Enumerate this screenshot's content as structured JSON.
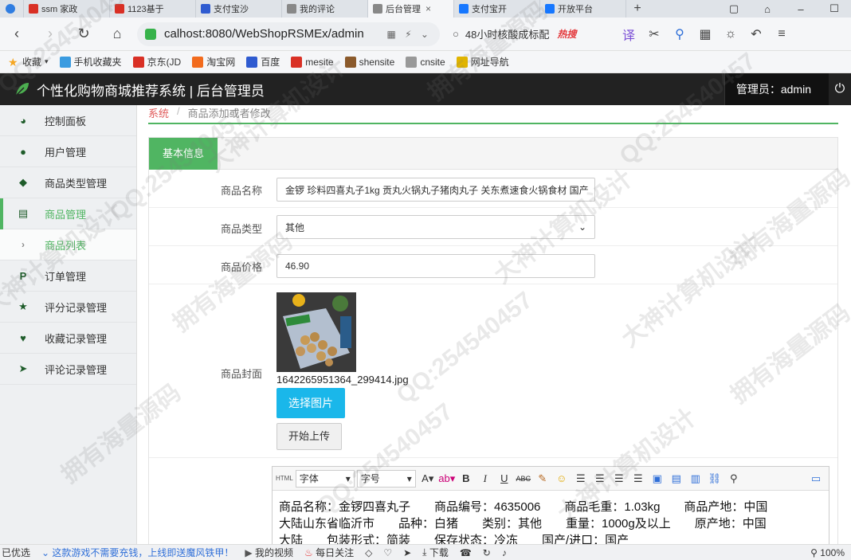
{
  "browser": {
    "tabs": [
      {
        "label": "ssm 家政",
        "color": "#d93025"
      },
      {
        "label": "1123基于",
        "color": "#d93025"
      },
      {
        "label": "支付宝沙",
        "color": "#2f5bd0"
      },
      {
        "label": "我的评论",
        "color": "#888888"
      },
      {
        "label": "后台管理",
        "color": "#888888",
        "active": true
      },
      {
        "label": "支付宝开",
        "color": "#1677ff"
      },
      {
        "label": "开放平台",
        "color": "#1677ff"
      }
    ],
    "address": "calhost:8080/WebShopRSMEx/admin",
    "search_text": "48小时核酸成标配",
    "search_hot": "热搜",
    "bookmarks": [
      "收藏",
      "手机收藏夹",
      "京东(JD",
      "淘宝网",
      "百度",
      "mesite",
      "shensite",
      "cnsite",
      "网址导航"
    ]
  },
  "app": {
    "title": "个性化购物商城推荐系统 | 后台管理员",
    "admin_label": "管理员：admin"
  },
  "sidebar": {
    "items": [
      {
        "label": "控制面板",
        "icon": "dashboard-icon"
      },
      {
        "label": "用户管理",
        "icon": "user-icon"
      },
      {
        "label": "商品类型管理",
        "icon": "tags-icon"
      },
      {
        "label": "商品管理",
        "icon": "barcode-icon",
        "active": true
      },
      {
        "label": "商品列表",
        "icon": "chevron-right-icon",
        "sub": true
      },
      {
        "label": "订单管理",
        "icon": "paypal-icon"
      },
      {
        "label": "评分记录管理",
        "icon": "star-icon"
      },
      {
        "label": "收藏记录管理",
        "icon": "heart-icon"
      },
      {
        "label": "评论记录管理",
        "icon": "send-icon"
      }
    ]
  },
  "breadcrumb": {
    "root": "系统",
    "current": "商品添加或者修改"
  },
  "form": {
    "section_tab": "基本信息",
    "name_label": "商品名称",
    "name_value": "金锣 珍料四喜丸子1kg 贡丸火锅丸子猪肉丸子 关东煮速食火锅食材 国产",
    "type_label": "商品类型",
    "type_value": "其他",
    "price_label": "商品价格",
    "price_value": "46.90",
    "cover_label": "商品封面",
    "cover_filename": "1642265951364_299414.jpg",
    "choose_button": "选择图片",
    "upload_button": "开始上传"
  },
  "editor": {
    "font_label": "字体",
    "size_label": "字号",
    "lines": [
      "商品名称：金锣四喜丸子　　商品编号：4635006　　商品毛重：1.03kg　　商品产地：中国",
      "大陆山东省临沂市　　品种：白猪　　类别：其他　　重量：1000g及以上　　原产地：中国",
      "大陆　　包装形式：简装　　保存状态：冷冻　　国产/进口：国产"
    ]
  },
  "statusbar": {
    "left": "已优选",
    "ad": "这款游戏不需要充钱，上线即送魔风铁甲！",
    "video": "我的视频",
    "daily": "每日关注",
    "download": "下载",
    "zoom": "100%"
  },
  "watermark": {
    "texts": [
      "QQ:254540457",
      "大神计算机设计",
      "拥有海量源码"
    ]
  }
}
